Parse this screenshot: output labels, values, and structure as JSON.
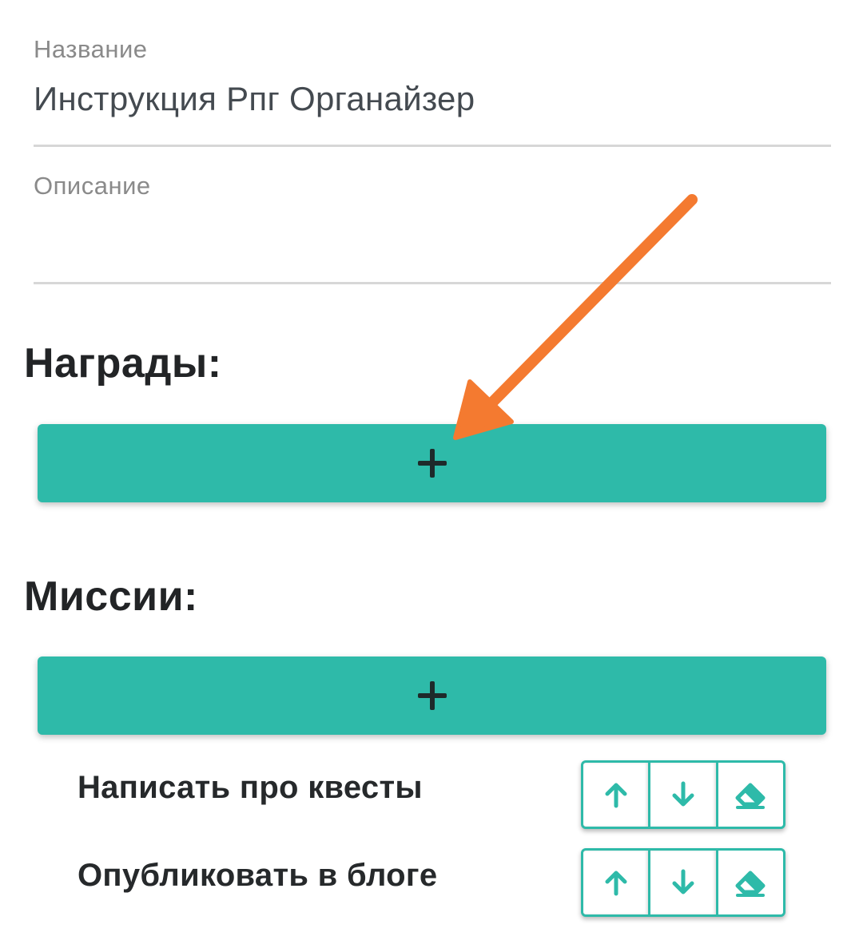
{
  "form": {
    "name_label": "Название",
    "name_value": "Инструкция Рпг Органайзер",
    "description_label": "Описание",
    "description_value": ""
  },
  "rewards": {
    "heading": "Награды:",
    "add_label": "+"
  },
  "missions": {
    "heading": "Миссии:",
    "add_label": "+",
    "items": [
      {
        "label": "Написать про квесты"
      },
      {
        "label": "Опубликовать в блоге"
      }
    ]
  },
  "icons": {
    "move_up": "arrow-up-icon",
    "move_down": "arrow-down-icon",
    "delete": "eraser-icon",
    "add": "plus-icon"
  },
  "colors": {
    "accent": "#2ebaa9",
    "annotation_arrow": "#f47a30",
    "heading_text": "#222426",
    "label_text": "#8a8a8a",
    "divider": "#d7d7d7"
  }
}
